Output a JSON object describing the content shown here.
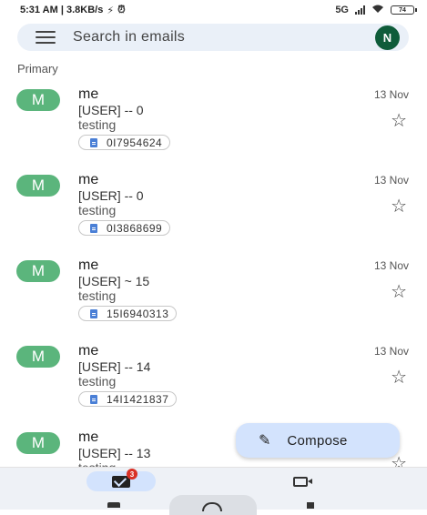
{
  "status_bar": {
    "time_and_speed": "5:31 AM | 3.8KB/s",
    "status_icons": [
      "vibrate-icon",
      "alarm-icon"
    ],
    "network": "5G",
    "battery": "74"
  },
  "search": {
    "placeholder": "Search in emails",
    "avatar_letter": "N"
  },
  "section": "Primary",
  "emails": [
    {
      "avatar": "M",
      "sender": "me",
      "date": "13 Nov",
      "subject": "[USER] -- 0",
      "snippet": "testing",
      "attachment": "0I7954624"
    },
    {
      "avatar": "M",
      "sender": "me",
      "date": "13 Nov",
      "subject": "[USER] -- 0",
      "snippet": "testing",
      "attachment": "0I3868699"
    },
    {
      "avatar": "M",
      "sender": "me",
      "date": "13 Nov",
      "subject": "[USER] ~ 15",
      "snippet": "testing",
      "attachment": "15I6940313"
    },
    {
      "avatar": "M",
      "sender": "me",
      "date": "13 Nov",
      "subject": "[USER] -- 14",
      "snippet": "testing",
      "attachment": "14I1421837"
    },
    {
      "avatar": "M",
      "sender": "me",
      "date": "",
      "subject": "[USER] -- 13",
      "snippet": "testing",
      "attachment": ""
    }
  ],
  "compose": {
    "label": "Compose"
  },
  "bottom_nav": {
    "mail_badge": "3"
  },
  "colors": {
    "accent": "#d3e3fd",
    "avatar_green": "#5bb57c",
    "account_avatar": "#0f5c3a",
    "badge_red": "#d93025"
  }
}
